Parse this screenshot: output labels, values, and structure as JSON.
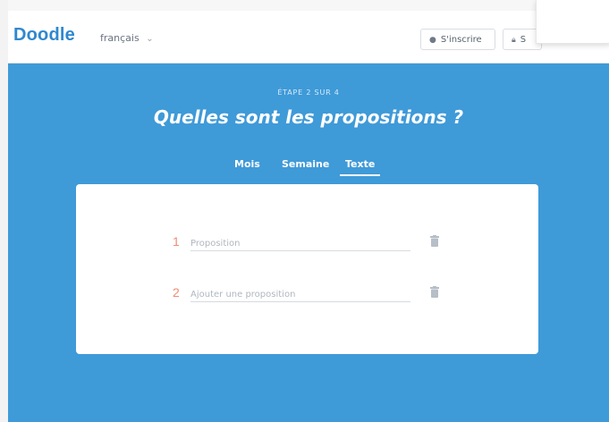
{
  "header": {
    "logo": "Doodle",
    "language": "français",
    "signup_label": "S'inscrire",
    "login_label": "S"
  },
  "step": {
    "label": "ÉTAPE 2 SUR 4",
    "title": "Quelles sont les propositions ?"
  },
  "tabs": [
    {
      "label": "Mois",
      "active": false
    },
    {
      "label": "Semaine",
      "active": false
    },
    {
      "label": "Texte",
      "active": true
    }
  ],
  "options": [
    {
      "number": "1",
      "value": "",
      "placeholder": "Proposition"
    },
    {
      "number": "2",
      "value": "",
      "placeholder": "Ajouter une proposition"
    }
  ],
  "icons": {
    "signup": "user-icon",
    "login": "lock-icon",
    "language_dropdown": "chevron-down-icon",
    "delete": "trash-icon"
  },
  "colors": {
    "brand": "#2f88cf",
    "hero": "#3f9ad8",
    "number": "#f08c73"
  }
}
